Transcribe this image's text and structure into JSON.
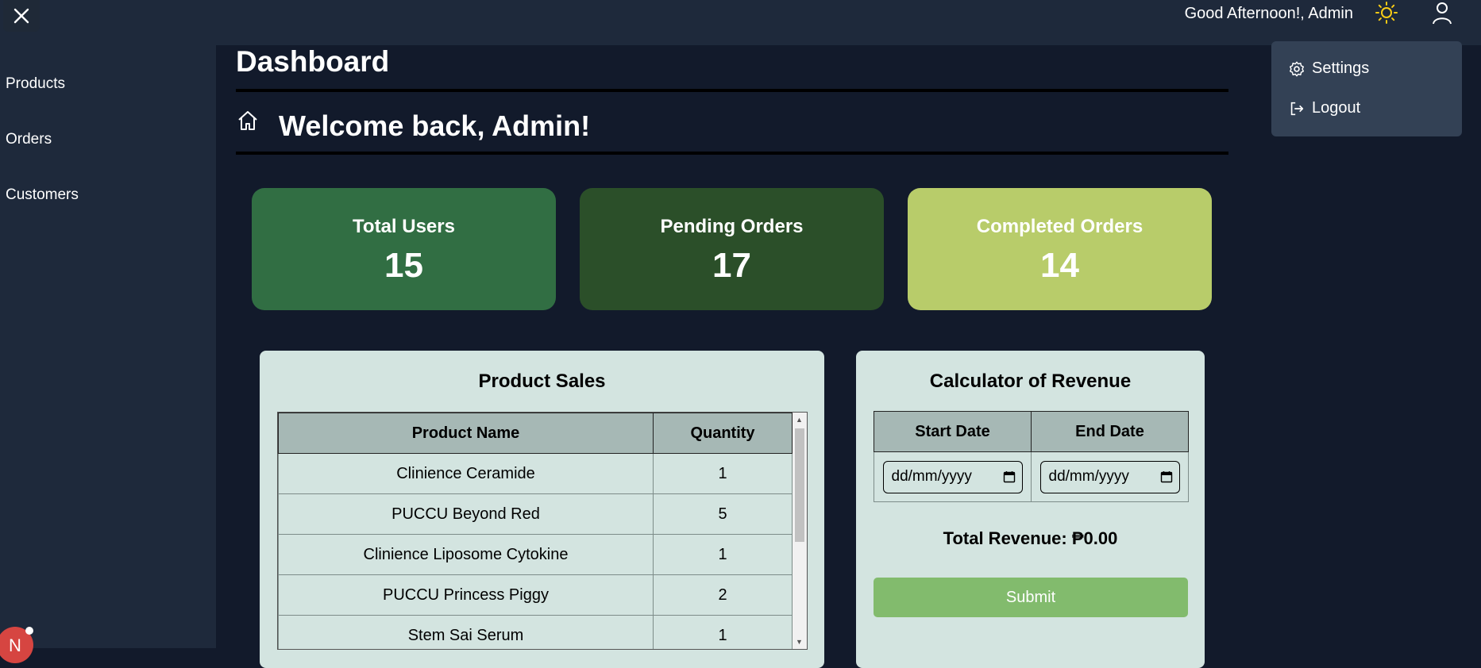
{
  "header": {
    "greeting": "Good Afternoon!, Admin",
    "close_icon": "close-icon",
    "theme_icon": "sun-icon",
    "user_icon": "user-icon",
    "accent_color": "#facc15"
  },
  "sidebar": {
    "items": [
      {
        "label": "Products"
      },
      {
        "label": "Orders"
      },
      {
        "label": "Customers"
      }
    ],
    "notification_letter": "N"
  },
  "main": {
    "title": "Dashboard",
    "welcome": "Welcome back, Admin!",
    "stats": [
      {
        "label": "Total Users",
        "value": "15",
        "color": "#316e43"
      },
      {
        "label": "Pending Orders",
        "value": "17",
        "color": "#2b4f29"
      },
      {
        "label": "Completed Orders",
        "value": "14",
        "color": "#b8cc6a"
      }
    ]
  },
  "sales": {
    "title": "Product Sales",
    "columns": [
      "Product Name",
      "Quantity"
    ],
    "rows": [
      {
        "name": "Clinience Ceramide",
        "qty": "1"
      },
      {
        "name": "PUCCU Beyond Red",
        "qty": "5"
      },
      {
        "name": "Clinience Liposome Cytokine",
        "qty": "1"
      },
      {
        "name": "PUCCU Princess Piggy",
        "qty": "2"
      },
      {
        "name": "Stem Sai Serum",
        "qty": "1"
      }
    ]
  },
  "revenue": {
    "title": "Calculator of Revenue",
    "start_label": "Start Date",
    "end_label": "End Date",
    "date_placeholder": "dd/mm/yyyy",
    "total_label": "Total Revenue: ₱0.00",
    "submit_label": "Submit",
    "submit_color": "#82bb6d"
  },
  "user_menu": {
    "items": [
      {
        "label": "Settings",
        "icon": "gear-icon"
      },
      {
        "label": "Logout",
        "icon": "logout-icon"
      }
    ]
  }
}
